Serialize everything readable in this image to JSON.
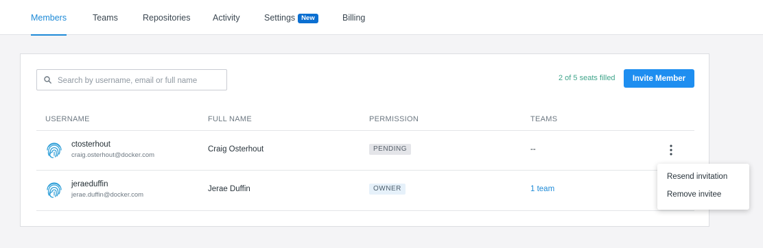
{
  "nav": {
    "tabs": [
      {
        "label": "Members",
        "active": true
      },
      {
        "label": "Teams"
      },
      {
        "label": "Repositories"
      },
      {
        "label": "Activity"
      },
      {
        "label": "Settings",
        "badge": "New"
      },
      {
        "label": "Billing"
      }
    ]
  },
  "toolbar": {
    "search_placeholder": "Search by username, email or full name",
    "search_value": "",
    "seats_text": "2 of 5 seats filled",
    "invite_label": "Invite Member"
  },
  "table": {
    "headers": [
      "USERNAME",
      "FULL NAME",
      "PERMISSION",
      "TEAMS"
    ],
    "rows": [
      {
        "username": "ctosterhout",
        "email": "craig.osterhout@docker.com",
        "full_name": "Craig Osterhout",
        "permission": "PENDING",
        "teams": "--"
      },
      {
        "username": "jeraeduffin",
        "email": "jerae.duffin@docker.com",
        "full_name": "Jerae Duffin",
        "permission": "OWNER",
        "teams": "1 team"
      }
    ]
  },
  "menu": {
    "items": [
      "Resend invitation",
      "Remove invitee"
    ]
  },
  "colors": {
    "accent": "#1d8ad7",
    "button": "#1e8ef0",
    "seats": "#3fa48a",
    "badge": "#0b6fd1"
  }
}
